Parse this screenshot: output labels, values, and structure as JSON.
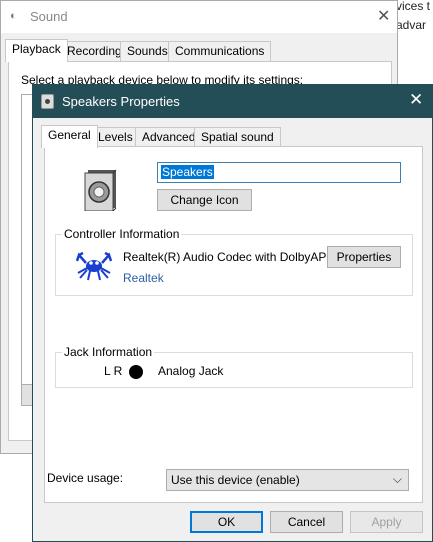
{
  "background": {
    "partial_text_1": "vices t",
    "partial_text_2": "advar"
  },
  "sound_window": {
    "title": "Sound",
    "icon": "speaker-icon",
    "close_label": "✕",
    "tabs": [
      {
        "label": "Playback",
        "active": true
      },
      {
        "label": "Recording",
        "active": false
      },
      {
        "label": "Sounds",
        "active": false
      },
      {
        "label": "Communications",
        "active": false
      }
    ],
    "prompt": "Select a playback device below to modify its settings:"
  },
  "dialog": {
    "title": "Speakers Properties",
    "icon": "speaker-properties-icon",
    "close_label": "✕",
    "tabs": [
      {
        "label": "General",
        "active": true
      },
      {
        "label": "Levels",
        "active": false
      },
      {
        "label": "Advanced",
        "active": false
      },
      {
        "label": "Spatial sound",
        "active": false
      }
    ],
    "device_name": "Speakers",
    "change_icon_label": "Change Icon",
    "controller": {
      "legend": "Controller Information",
      "name": "Realtek(R) Audio Codec with DolbyAPO",
      "vendor_link": "Realtek",
      "properties_label": "Properties",
      "logo_icon": "realtek-crab-icon"
    },
    "jack": {
      "legend": "Jack Information",
      "channels": "L R",
      "type": "Analog Jack",
      "jack_icon": "jack-dot-icon"
    },
    "usage": {
      "label": "Device usage:",
      "selected": "Use this device (enable)"
    },
    "buttons": {
      "ok": "OK",
      "cancel": "Cancel",
      "apply": "Apply"
    }
  },
  "colors": {
    "titlebar": "#244e57",
    "link": "#2e5ea7",
    "selection": "#0078d7",
    "realtek_blue": "#1a3fd0"
  }
}
